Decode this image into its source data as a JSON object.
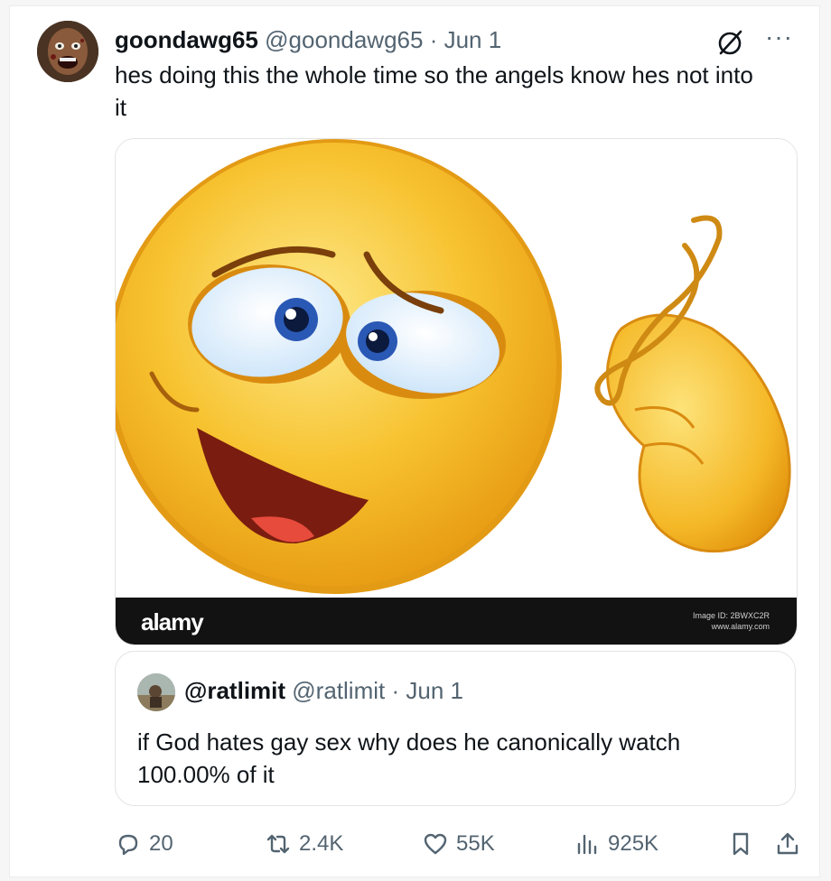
{
  "tweet": {
    "display_name": "goondawg65",
    "handle": "@goondawg65",
    "separator": "·",
    "date": "Jun 1",
    "text": "hes doing this the whole time so the angels know hes not into it",
    "menu_glyph": "···",
    "icons": [
      "grok-icon",
      "more-options-icon"
    ]
  },
  "media": {
    "brand": "alamy",
    "image_id_line": "Image ID: 2BWXC2R",
    "site_line": "www.alamy.com"
  },
  "quote": {
    "display_name": "@ratlimit",
    "handle": "@ratlimit",
    "separator": "·",
    "date": "Jun 1",
    "text": "if God hates gay sex why does he canonically watch 100.00% of it"
  },
  "actions": {
    "replies": "20",
    "reposts": "2.4K",
    "likes": "55K",
    "views": "925K",
    "icons": [
      "reply-icon",
      "repost-icon",
      "like-icon",
      "views-icon",
      "bookmark-icon",
      "share-icon"
    ]
  },
  "colors": {
    "text_primary": "#0f1419",
    "text_secondary": "#536471",
    "border": "#e3e3e3",
    "emoji_yellow": "#f7c22f"
  }
}
